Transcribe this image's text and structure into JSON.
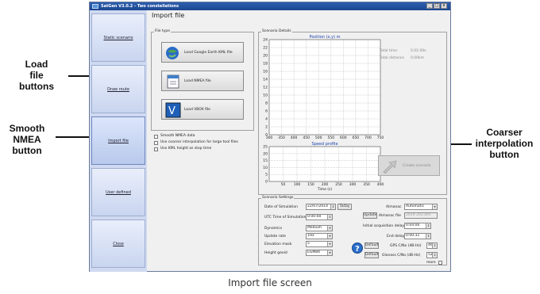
{
  "annotations": {
    "load_file_buttons": [
      "Load",
      "file",
      "buttons"
    ],
    "smooth_nmea_button": [
      "Smooth",
      "NMEA",
      "button"
    ],
    "coarser_interpolation_button": [
      "Coarser",
      "interpolation",
      "button"
    ],
    "caption": "Import file screen"
  },
  "window": {
    "title": "SatGen V3.0.2 - Two constellations",
    "controls": [
      "_",
      "□",
      "x"
    ]
  },
  "sidebar": {
    "items": [
      {
        "label": "Static scenario"
      },
      {
        "label": "Draw route"
      },
      {
        "label": "Import file"
      },
      {
        "label": "User defined"
      },
      {
        "label": "Close"
      }
    ],
    "active": "Import file"
  },
  "main": {
    "title": "Import file",
    "file_type": {
      "legend": "File type",
      "buttons": [
        {
          "label": "Load Google Earth KML file"
        },
        {
          "label": "Load NMEA file"
        },
        {
          "label": "Load VBOX file"
        }
      ]
    },
    "options": [
      {
        "label": "Smooth NMEA data",
        "checked": false
      },
      {
        "label": "Use coarser interpolation for large tool files",
        "checked": false
      },
      {
        "label": "Use KML height as stop time",
        "checked": false
      }
    ],
    "scenario_details": {
      "legend": "Scenario Details",
      "total_time_label": "Total time",
      "total_time_value": "0.02.00s",
      "total_distance_label": "Total distance",
      "total_distance_value": "0.00km",
      "create_label": "Create scenario"
    },
    "scenario_settings": {
      "legend": "Scenario Settings",
      "date_label": "Date of Simulation",
      "date_value": "22/07/2014",
      "today_label": "Today",
      "utc_label": "UTC Time of Simulation",
      "utc_value": "0:00:00",
      "dynamics_label": "Dynamics",
      "dynamics_value": "Medium",
      "update_rate_label": "Update rate",
      "update_rate_value": "1Hz",
      "elevation_label": "Elevation mask",
      "elevation_value": "5",
      "geoid_label": "Height geoid",
      "geoid_value": "EGM84",
      "almanac_label": "Almanac",
      "almanac_value": "Automatic",
      "update_label": "Update",
      "almanac_file_label": "Almanac file",
      "almanac_file_value": "2014-203.alm",
      "init_delay_label": "Initial acquisition delay",
      "init_delay_value": "0:04:00",
      "end_delay_label": "End delay",
      "end_delay_value": "0:00:31",
      "default_label": "Default",
      "gps_label": "GPS C/No (dB-Hz)",
      "gps_value": "46",
      "glonass_label": "Glonass C/No (dB-Hz)",
      "glonass_value": "52",
      "more_label": "more"
    }
  },
  "chart_data": [
    {
      "type": "line",
      "title": "Position (x,y) m",
      "xlabel": "",
      "ylabel": "",
      "xlim": [
        300,
        750
      ],
      "ylim": [
        0,
        24
      ],
      "x_ticks": [
        300,
        350,
        400,
        450,
        500,
        550,
        600,
        650,
        700,
        750
      ],
      "y_ticks": [
        0,
        2,
        4,
        6,
        8,
        10,
        12,
        14,
        16,
        18,
        20,
        22,
        24
      ],
      "grid": true,
      "series": []
    },
    {
      "type": "line",
      "title": "Speed profile",
      "xlabel": "Time (s)",
      "ylabel": "",
      "xlim": [
        0,
        400
      ],
      "ylim": [
        0,
        25
      ],
      "x_ticks": [
        50,
        100,
        150,
        200,
        250,
        300,
        350,
        400
      ],
      "y_ticks": [
        0,
        5,
        10,
        15,
        20,
        25
      ],
      "grid": true,
      "series": []
    }
  ]
}
